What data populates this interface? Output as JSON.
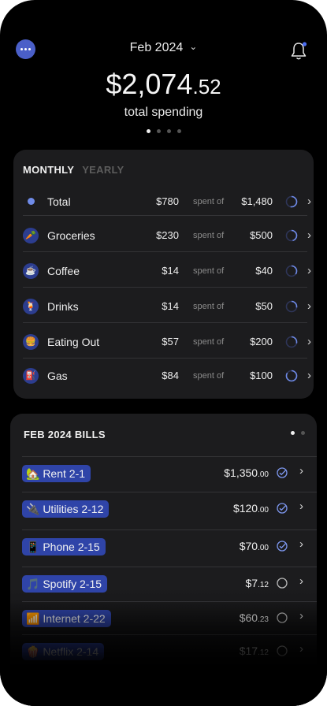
{
  "header": {
    "month": "Feb 2024",
    "total_dollars": "$2,074",
    "total_cents": ".52",
    "total_label": "total spending",
    "page_dots": 4,
    "active_dot": 0
  },
  "budget": {
    "tabs": [
      "MONTHLY",
      "YEARLY"
    ],
    "active_tab": "MONTHLY",
    "spent_of_label": "spent of",
    "rows": [
      {
        "name": "Total",
        "icon": "bullet",
        "spent": "$780",
        "budget": "$1,480",
        "progress": 0.53
      },
      {
        "name": "Groceries",
        "icon": "carrot-icon",
        "glyph": "🥕",
        "spent": "$230",
        "budget": "$500",
        "progress": 0.46
      },
      {
        "name": "Coffee",
        "icon": "coffee-icon",
        "glyph": "☕",
        "spent": "$14",
        "budget": "$40",
        "progress": 0.35
      },
      {
        "name": "Drinks",
        "icon": "drink-icon",
        "glyph": "🍹",
        "spent": "$14",
        "budget": "$50",
        "progress": 0.28
      },
      {
        "name": "Eating Out",
        "icon": "burger-icon",
        "glyph": "🍔",
        "spent": "$57",
        "budget": "$200",
        "progress": 0.29
      },
      {
        "name": "Gas",
        "icon": "gas-pump-icon",
        "glyph": "⛽",
        "spent": "$84",
        "budget": "$100",
        "progress": 0.84
      }
    ]
  },
  "bills": {
    "title": "FEB 2024 BILLS",
    "page_dots": 2,
    "active_dot": 0,
    "items": [
      {
        "label": "🏡 Rent 2-1",
        "dollars": "$1,350",
        "cents": ".00",
        "paid": true
      },
      {
        "label": "🔌 Utilities 2-12",
        "dollars": "$120",
        "cents": ".00",
        "paid": true
      },
      {
        "label": "📱 Phone 2-15",
        "dollars": "$70",
        "cents": ".00",
        "paid": true
      },
      {
        "label": "🎵 Spotify 2-15",
        "dollars": "$7",
        "cents": ".12",
        "paid": false
      },
      {
        "label": "📶 Internet 2-22",
        "dollars": "$60",
        "cents": ".23",
        "paid": false
      },
      {
        "label": "🍿 Netflix 2-14",
        "dollars": "$17",
        "cents": ".12",
        "paid": false
      }
    ]
  },
  "colors": {
    "accent": "#4a5fc8",
    "tag_bg": "#2f44a8",
    "card_bg": "#1c1c1e",
    "progress_ring": "#6f8be8"
  }
}
